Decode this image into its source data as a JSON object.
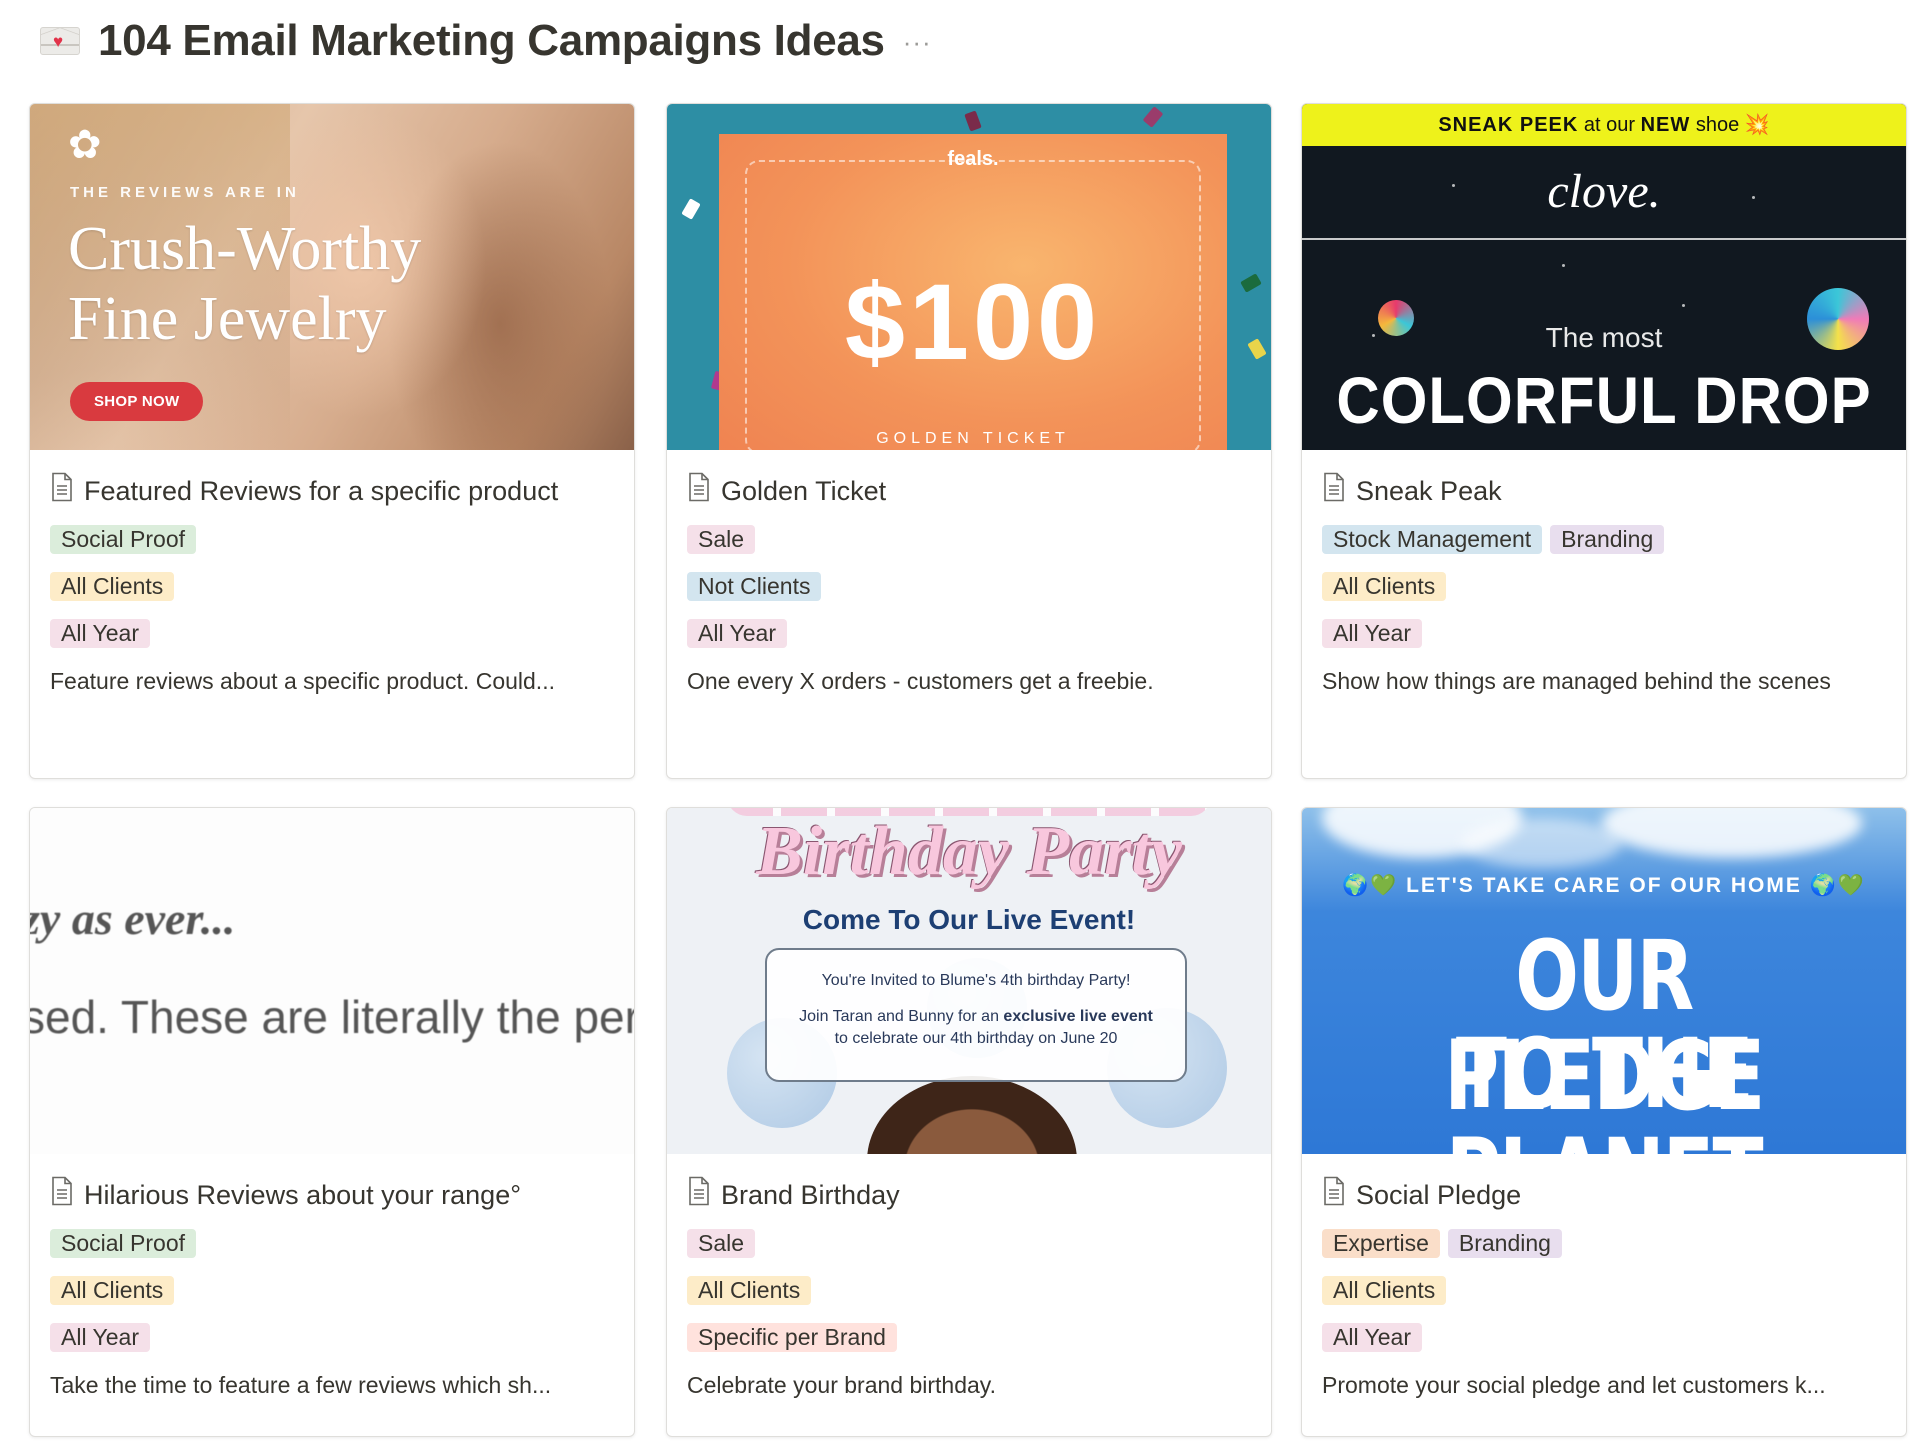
{
  "page": {
    "title": "104 Email Marketing Campaigns Ideas",
    "icon": "love-letter-icon",
    "more": "···"
  },
  "colors": {
    "tag_green": "#dbeddb",
    "tag_yellow": "#fdecc8",
    "tag_pink": "#f5e0e9",
    "tag_blue": "#d3e5ef",
    "tag_purple": "#e8deee",
    "tag_orange": "#fadec9",
    "tag_red": "#ffe2dd"
  },
  "cards": [
    {
      "title": "Featured Reviews for a specific product",
      "tags": [
        "Social Proof",
        "All Clients",
        "All Year"
      ],
      "description": "Feature reviews about a specific product. Could...",
      "cover": {
        "kicker": "THE REVIEWS ARE IN",
        "headline_1": "Crush-Worthy",
        "headline_2": "Fine Jewelry",
        "button": "SHOP NOW"
      }
    },
    {
      "title": "Golden Ticket",
      "tags": [
        "Sale",
        "Not Clients",
        "All Year"
      ],
      "description": "One every X orders - customers get a freebie.",
      "cover": {
        "brand": "feals.",
        "amount": "$100",
        "caption": "GOLDEN TICKET"
      }
    },
    {
      "title": "Sneak Peak",
      "tags": [
        "Stock Management",
        "Branding",
        "All Clients",
        "All Year"
      ],
      "description": "Show how things are managed behind the scenes",
      "cover": {
        "banner_1": "SNEAK PEEK",
        "banner_2": " at our ",
        "banner_3": "NEW",
        "banner_4": " shoe 💥",
        "logo": "clove.",
        "line_1": "The most",
        "line_2": "COLORFUL DROP"
      }
    },
    {
      "title": "Hilarious Reviews about your range°",
      "tags": [
        "Social Proof",
        "All Clients",
        "All Year"
      ],
      "description": "Take the time to feature a few reviews which sh...",
      "cover": {
        "line_1": "zy as ever...",
        "line_2": "sed.  These are literally the per"
      }
    },
    {
      "title": "Brand Birthday",
      "tags": [
        "Sale",
        "All Clients",
        "Specific per Brand"
      ],
      "description": "Celebrate your brand birthday.",
      "cover": {
        "headline": "Birthday Party",
        "subhead": "Come To Our Live Event!",
        "invite_1": "You're Invited to Blume's 4th birthday Party!",
        "invite_2a": "Join Taran and Bunny for an ",
        "invite_2b": "exclusive live event",
        "invite_3": "to celebrate our 4th birthday on June 20"
      }
    },
    {
      "title": "Social Pledge",
      "tags": [
        "Expertise",
        "Branding",
        "All Clients",
        "All Year"
      ],
      "description": "Promote your social pledge and let customers k...",
      "cover": {
        "kicker": "🌍💚 LET'S TAKE CARE OF OUR HOME 🌍💚",
        "line_1": "OUR PLEDGE",
        "line_2": "TO THE PLANET"
      }
    }
  ]
}
